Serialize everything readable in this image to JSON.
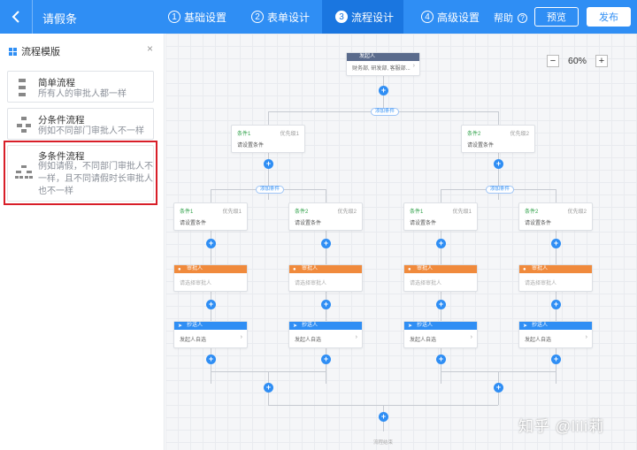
{
  "header": {
    "back_icon": "chevron-left-icon",
    "title": "请假条",
    "steps": [
      {
        "num": "1",
        "label": "基础设置"
      },
      {
        "num": "2",
        "label": "表单设计"
      },
      {
        "num": "3",
        "label": "流程设计"
      },
      {
        "num": "4",
        "label": "高级设置"
      }
    ],
    "help": "帮助",
    "help_icon": "question-circle-icon",
    "preview": "预览",
    "publish": "发布",
    "accent": "#2f8ef4",
    "active_step_bg": "#1a76e0"
  },
  "left_panel": {
    "title": "流程模版",
    "close": "×",
    "templates": [
      {
        "title": "简单流程",
        "desc": "所有人的审批人都一样"
      },
      {
        "title": "分条件流程",
        "desc": "例如不同部门审批人不一样"
      },
      {
        "title": "多条件流程",
        "desc_lines": [
          "例如请假，不同部门审批人不",
          "一样，且不同请假时长审批人",
          "也不一样"
        ]
      }
    ],
    "highlight_color": "#d81e28"
  },
  "canvas": {
    "zoom": {
      "minus": "−",
      "value": "60%",
      "plus": "+"
    },
    "initiator": {
      "title": "发起人",
      "body": "财务部, 研发部, 客服部...",
      "arrow": "›"
    },
    "add_condition": "添加条件",
    "outer_conditions": [
      {
        "name": "条件1",
        "priority": "优先级1",
        "body": "请设置条件"
      },
      {
        "name": "条件2",
        "priority": "优先级2",
        "body": "请设置条件"
      }
    ],
    "inner_conditions": [
      {
        "name": "条件1",
        "priority": "优先级1",
        "body": "请设置条件"
      },
      {
        "name": "条件2",
        "priority": "优先级2",
        "body": "请设置条件"
      },
      {
        "name": "条件1",
        "priority": "优先级1",
        "body": "请设置条件"
      },
      {
        "name": "条件2",
        "priority": "优先级2",
        "body": "请设置条件"
      }
    ],
    "approver": {
      "title": "审批人",
      "body": "请选择审批人",
      "color": "#f08a3c"
    },
    "cc": {
      "title": "抄送人",
      "body": "发起人自选",
      "color": "#2f8ef4"
    },
    "end": "流程结束"
  },
  "watermark": "知乎 @lili莉"
}
